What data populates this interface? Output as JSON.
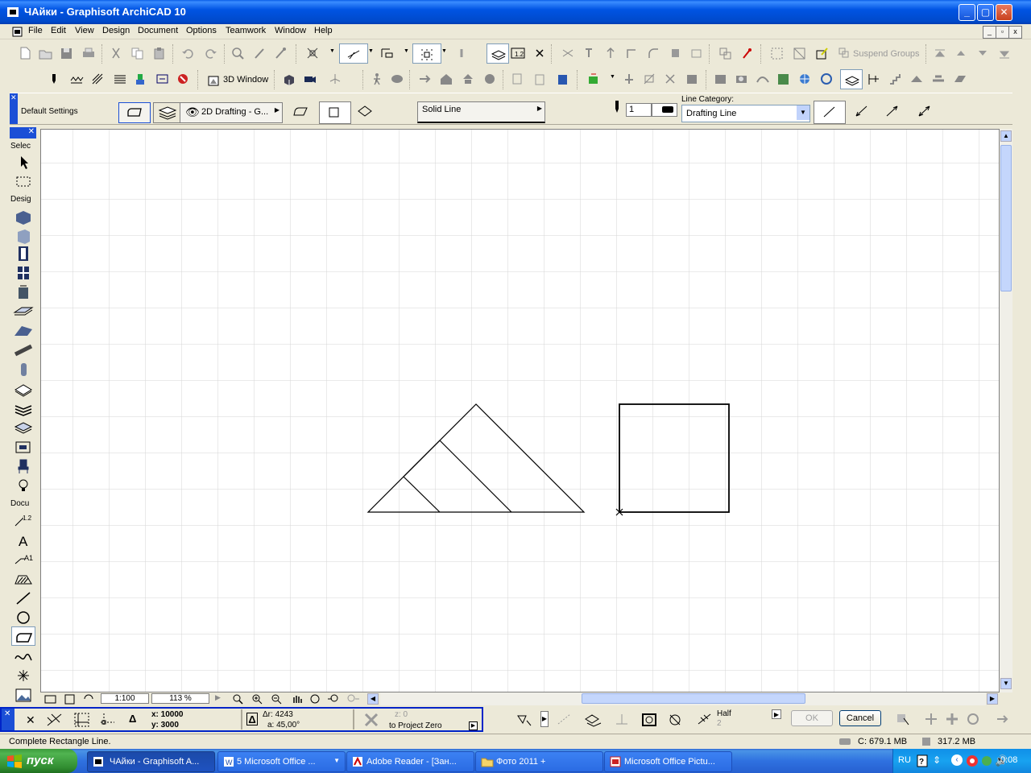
{
  "window": {
    "title": "ЧАйки - Graphisoft ArchiCAD 10"
  },
  "menubar": {
    "items": [
      "File",
      "Edit",
      "View",
      "Design",
      "Document",
      "Options",
      "Teamwork",
      "Window",
      "Help"
    ]
  },
  "toolbar": {
    "suspend_groups_label": "Suspend Groups",
    "window_3d_label": "3D Window"
  },
  "infobox": {
    "settings_label": "Default Settings",
    "layer_label": "2D Drafting - G...",
    "line_type": "Solid Line",
    "pen_number": "1",
    "line_category_label": "Line Category:",
    "line_category_value": "Drafting Line"
  },
  "toolbox": {
    "sections": [
      "Selec",
      "Desig",
      "Docu"
    ]
  },
  "navigation": {
    "scale": "1:100",
    "zoom": "113 %"
  },
  "coordinates": {
    "x": "x: 10000",
    "y": "y: 3000",
    "dr": "Δr: 4243",
    "angle": "a: 45,00°",
    "z": "z: 0",
    "reference": "to Project Zero",
    "snap_label": "Half",
    "snap_value": "2",
    "ok_label": "OK",
    "cancel_label": "Cancel"
  },
  "status": {
    "message": "Complete Rectangle Line.",
    "cache": "C: 679.1 MB",
    "memory": "317.2 MB"
  },
  "taskbar": {
    "start_label": "пуск",
    "tasks": [
      "ЧАйки - Graphisoft A...",
      "5 Microsoft Office ...",
      "Adobe Reader - [Зан...",
      "Фото 2011 +",
      "Microsoft Office Pictu..."
    ],
    "language": "RU",
    "clock": "0:08"
  },
  "colors": {
    "title_blue": "#0054e3",
    "taskbar_blue": "#2f71e0",
    "start_green": "#3c9b3c",
    "grid_line": "#d8d8d8",
    "tracker_border": "#0024c8"
  }
}
